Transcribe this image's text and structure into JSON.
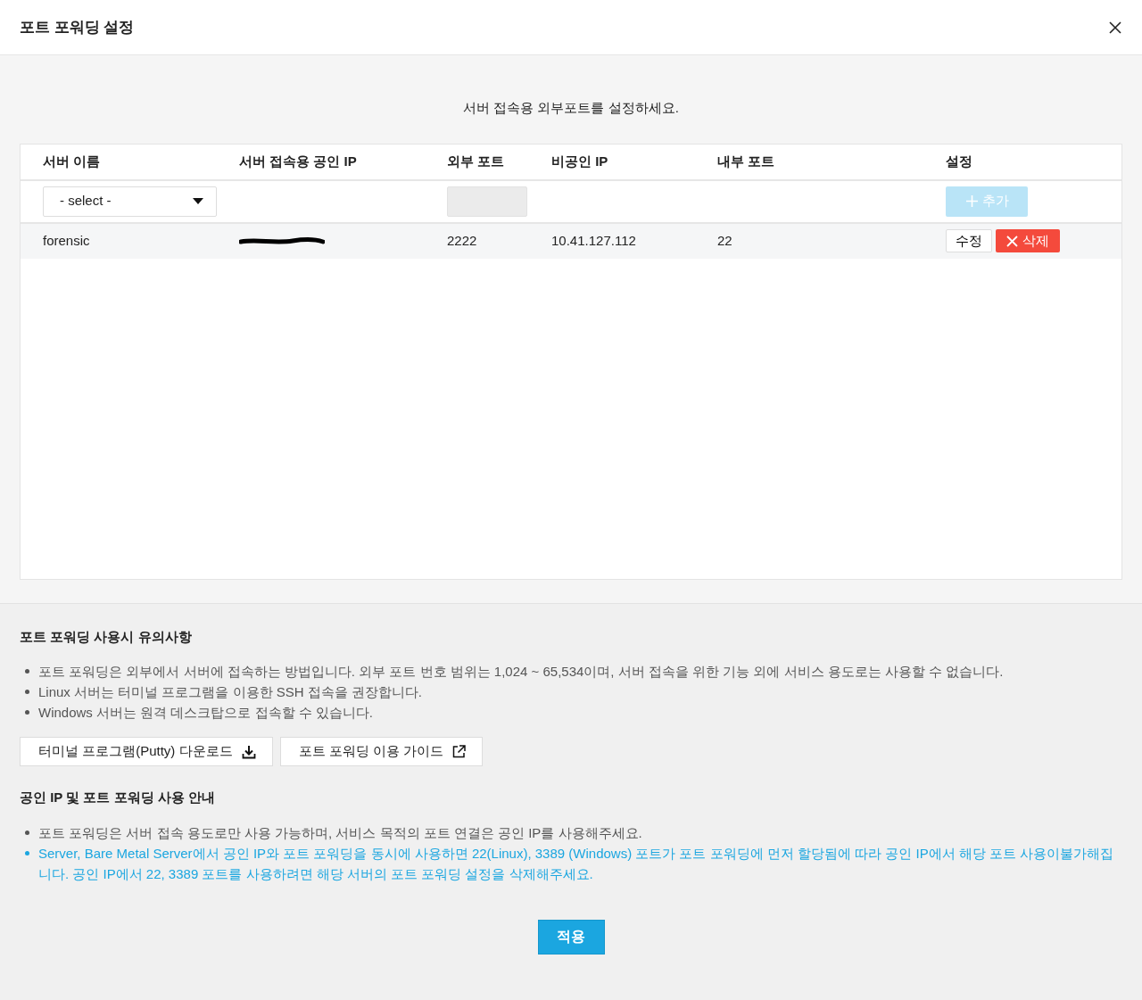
{
  "window": {
    "title": "포트 포워딩 설정"
  },
  "instruction": "서버 접속용 외부포트를 설정하세요.",
  "table": {
    "columns": [
      "서버 이름",
      "서버 접속용 공인 IP",
      "외부 포트",
      "비공인 IP",
      "내부 포트",
      "설정"
    ],
    "new_row": {
      "server_select": "- select -",
      "add_button": {
        "label": "추가",
        "disabled": true
      }
    },
    "rows": [
      {
        "server": "forensic",
        "public_ip_redacted": true,
        "external_port": "2222",
        "private_ip": "10.41.127.112",
        "internal_port": "22",
        "edit_button": "수정",
        "delete_button": "삭제"
      }
    ]
  },
  "cautions": {
    "title": "포트 포워딩 사용시 유의사항",
    "items": [
      {
        "text": "포트 포워딩은 외부에서 서버에 접속하는 방법입니다. 외부 포트 번호 범위는 1,024 ~ 65,534이며, 서버 접속을 위한 기능 외에 서비스 용도로는 사용할 수 없습니다.",
        "highlight": false
      },
      {
        "text": "Linux 서버는 터미널 프로그램을 이용한 SSH 접속을 권장합니다.",
        "highlight": false
      },
      {
        "text": "Windows 서버는 원격 데스크탑으로 접속할 수 있습니다.",
        "highlight": false
      }
    ],
    "buttons": [
      {
        "label": "터미널 프로그램(Putty) 다운로드",
        "kind": "download"
      },
      {
        "label": "포트 포워딩 이용 가이드",
        "kind": "external"
      }
    ]
  },
  "guide": {
    "title": "공인 IP 및 포트 포워딩 사용 안내",
    "items": [
      {
        "text": "포트 포워딩은 서버 접속 용도로만 사용 가능하며, 서비스 목적의 포트 연결은 공인 IP를 사용해주세요.",
        "highlight": false
      },
      {
        "text": "Server, Bare Metal Server에서 공인 IP와 포트 포워딩을 동시에 사용하면 22(Linux), 3389 (Windows) 포트가 포트 포워딩에 먼저 할당됨에 따라 공인 IP에서 해당 포트 사용이불가해집니다. 공인 IP에서 22, 3389 포트를 사용하려면 해당 서버의 포트 포워딩 설정을 삭제해주세요.",
        "highlight": true
      }
    ]
  },
  "apply_button": "적용"
}
